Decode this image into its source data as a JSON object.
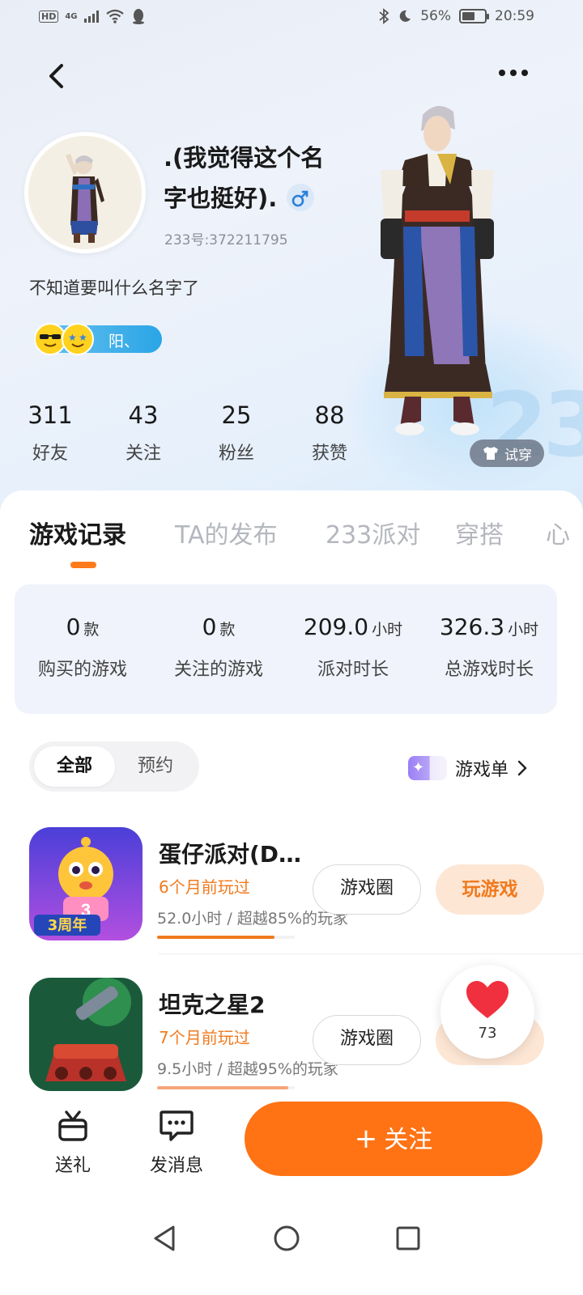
{
  "status_bar": {
    "hd": "HD",
    "network": "4G",
    "battery_percent": "56%",
    "battery_level": 0.56,
    "time": "20:59"
  },
  "profile": {
    "name": ".(我觉得这个名字也挺好).",
    "gender_symbol": "♂",
    "uid": "233号:372211795",
    "bio": "不知道要叫什么名字了",
    "medal_text": "阳、",
    "stats": [
      {
        "value": "311",
        "label": "好友"
      },
      {
        "value": "43",
        "label": "关注"
      },
      {
        "value": "25",
        "label": "粉丝"
      },
      {
        "value": "88",
        "label": "获赞"
      }
    ],
    "try_on_label": "试穿"
  },
  "tabs": [
    "游戏记录",
    "TA的发布",
    "233派对",
    "穿搭",
    "心"
  ],
  "summary": [
    {
      "value": "0",
      "unit": "款",
      "label": "购买的游戏"
    },
    {
      "value": "0",
      "unit": "款",
      "label": "关注的游戏"
    },
    {
      "value": "209.0",
      "unit": "小时",
      "label": "派对时长"
    },
    {
      "value": "326.3",
      "unit": "小时",
      "label": "总游戏时长"
    }
  ],
  "filter": {
    "options": [
      "全部",
      "预约"
    ],
    "selected": "全部"
  },
  "game_list_link": "游戏单",
  "games": [
    {
      "title": "蛋仔派对(D…",
      "played": "6个月前玩过",
      "hours": "52.0小时",
      "rank": "超越85%的玩家",
      "progress": 0.85,
      "circle_label": "游戏圈",
      "play_label": "玩游戏",
      "icon_badge": "3周年"
    },
    {
      "title": "坦克之星2",
      "played": "7个月前玩过",
      "hours": "9.5小时",
      "rank": "超越95%的玩家",
      "progress": 0.95,
      "circle_label": "游戏圈"
    }
  ],
  "like": {
    "count": "73"
  },
  "actions": {
    "gift": "送礼",
    "message": "发消息",
    "follow": "关注"
  },
  "colors": {
    "accent": "#ff7315",
    "accent_text": "#f07a1e",
    "medal_blue": "#2aa5e6"
  }
}
